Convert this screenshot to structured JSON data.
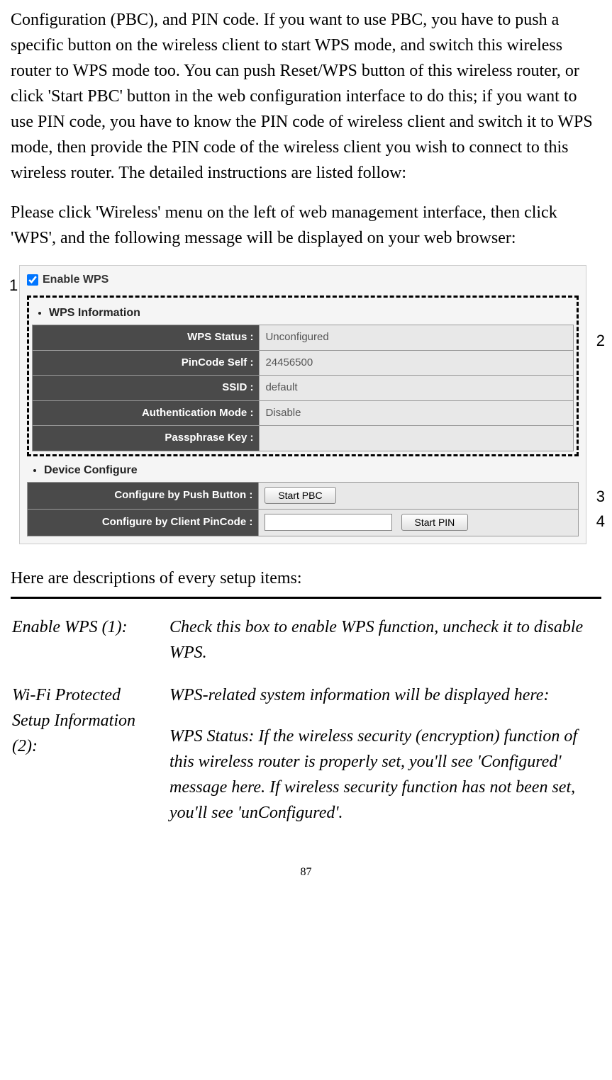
{
  "paragraph1": "Configuration (PBC), and PIN code. If you want to use PBC, you have to push a specific button on the wireless client to start WPS mode, and switch this wireless router to WPS mode too. You can push Reset/WPS button of this wireless router, or click 'Start PBC' button in the web configuration interface to do this; if you want to use PIN code, you have to know the PIN code of wireless client and switch it to WPS mode, then provide the PIN code of the wireless client you wish to connect to this wireless router. The detailed instructions are listed follow:",
  "paragraph2": "Please click 'Wireless' menu on the left of web management interface, then click 'WPS', and the following message will be displayed on your web browser:",
  "callouts": {
    "one": "1",
    "two": "2",
    "three": "3",
    "four": "4"
  },
  "panel": {
    "enable_wps_label": "Enable WPS",
    "section_wps_info": "WPS Information",
    "rows": {
      "wps_status_label": "WPS Status :",
      "wps_status_value": "Unconfigured",
      "pincode_label": "PinCode Self :",
      "pincode_value": "24456500",
      "ssid_label": "SSID :",
      "ssid_value": "default",
      "auth_label": "Authentication Mode :",
      "auth_value": "Disable",
      "passphrase_label": "Passphrase Key :",
      "passphrase_value": ""
    },
    "section_device_configure": "Device Configure",
    "device": {
      "push_button_label": "Configure by Push Button :",
      "push_button_btn": "Start PBC",
      "client_pin_label": "Configure by Client PinCode :",
      "client_pin_btn": "Start PIN"
    }
  },
  "intro_descriptions": "Here are descriptions of every setup items:",
  "setup_items": {
    "item1_label": "Enable WPS (1):",
    "item1_desc": "Check this box to enable WPS function, uncheck it to disable WPS.",
    "item2_label": "Wi-Fi Protected Setup Information (2):",
    "item2_desc": "WPS-related system information will be displayed here:",
    "item2_sub": "WPS Status: If the wireless security (encryption) function of this wireless router is properly set, you'll see 'Configured' message here. If wireless security function has not been set, you'll see 'unConfigured'."
  },
  "page_number": "87"
}
